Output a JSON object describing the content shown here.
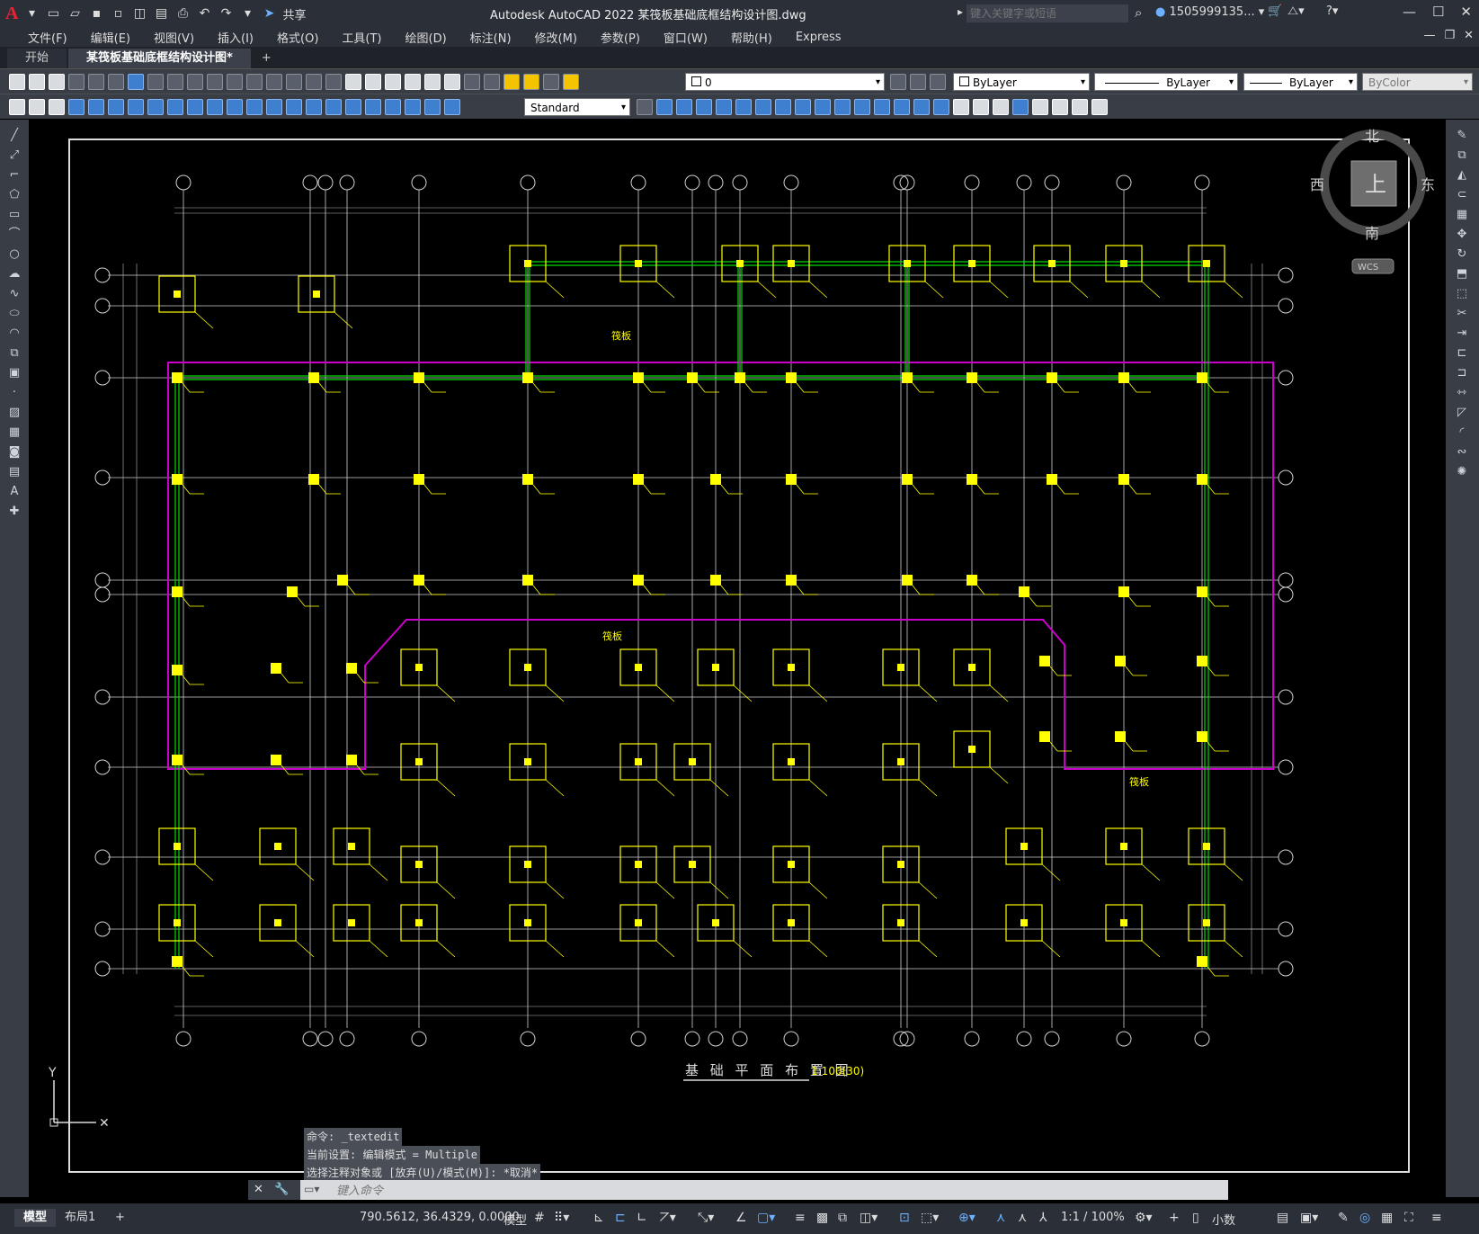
{
  "app": {
    "logo": "A",
    "title": "Autodesk AutoCAD 2022    某筏板基础底框结构设计图.dwg",
    "share_label": "共享",
    "search_placeholder": "键入关键字或短语",
    "user": "1505999135..."
  },
  "menu": [
    "文件(F)",
    "编辑(E)",
    "视图(V)",
    "插入(I)",
    "格式(O)",
    "工具(T)",
    "绘图(D)",
    "标注(N)",
    "修改(M)",
    "参数(P)",
    "窗口(W)",
    "帮助(H)",
    "Express"
  ],
  "tabs": [
    {
      "label": "开始",
      "active": false
    },
    {
      "label": "某筏板基础底框结构设计图*",
      "active": true
    },
    {
      "label": "+",
      "active": false
    }
  ],
  "toolbar": {
    "layer_value": "0",
    "color_value": "ByLayer",
    "linetype_value": "ByLayer",
    "lineweight_value": "ByLayer",
    "plotstyle_value": "ByColor",
    "textstyle_value": "Standard"
  },
  "viewcube": {
    "north": "北",
    "south": "南",
    "east": "东",
    "west": "西",
    "face": "上",
    "wcs": "WCS"
  },
  "drawing": {
    "title": "基 础 平 面 布 置 图",
    "scale": "1:100(30)",
    "hatch_label": "筏板",
    "ucs_y": "Y"
  },
  "command": {
    "history": [
      "命令: _textedit",
      "当前设置: 编辑模式 = Multiple",
      "选择注释对象或 [放弃(U)/模式(M)]: *取消*"
    ],
    "placeholder": "键入命令"
  },
  "status": {
    "model_tab": "模型",
    "layout_tab": "布局1",
    "add_tab": "+",
    "coords": "790.5612, 36.4329, 0.0000",
    "space": "模型",
    "scale": "1:1 / 100%",
    "units": "小数"
  },
  "colors": {
    "background": "#000000",
    "columns": "#ffff00",
    "beams": "#00dd00",
    "raft_outline": "#cc00cc",
    "grid": "#e6e6e6"
  }
}
